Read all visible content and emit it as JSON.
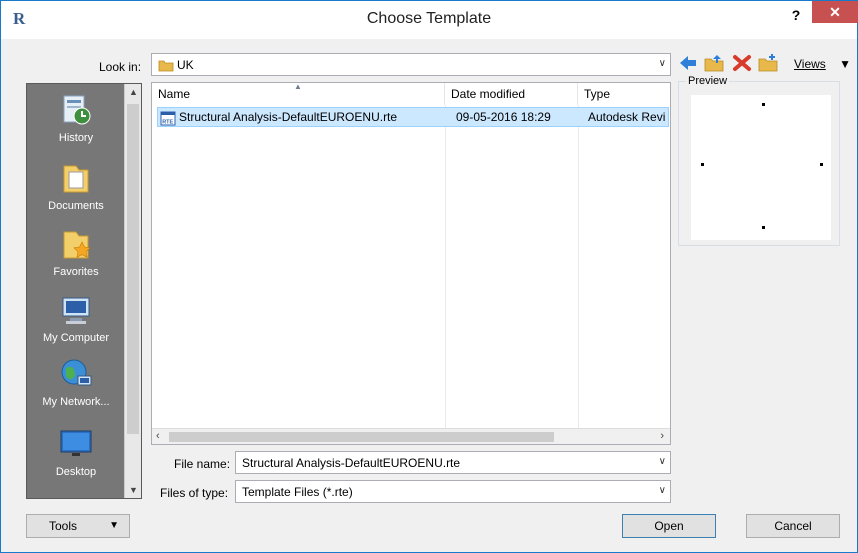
{
  "window": {
    "title": "Choose Template",
    "help_label": "?",
    "close_label": "✕",
    "app_icon": "revit-r-icon"
  },
  "look_in": {
    "label": "Look in:",
    "value": "UK"
  },
  "toolbar": {
    "icons": [
      "back-arrow-icon",
      "up-folder-icon",
      "delete-icon",
      "new-folder-icon"
    ],
    "views_label": "Views"
  },
  "places": [
    {
      "label": "History",
      "icon": "history-icon"
    },
    {
      "label": "Documents",
      "icon": "documents-folder-icon"
    },
    {
      "label": "Favorites",
      "icon": "favorites-folder-icon"
    },
    {
      "label": "My Computer",
      "icon": "my-computer-icon"
    },
    {
      "label": "My Network...",
      "icon": "network-globe-icon"
    },
    {
      "label": "Desktop",
      "icon": "desktop-monitor-icon"
    }
  ],
  "file_list": {
    "columns": [
      "Name",
      "Date modified",
      "Type"
    ],
    "rows": [
      {
        "name": "Structural Analysis-DefaultEUROENU.rte",
        "date_modified": "09-05-2016 18:29",
        "type": "Autodesk Revi"
      }
    ]
  },
  "preview": {
    "label": "Preview"
  },
  "file_name": {
    "label": "File name:",
    "value": "Structural Analysis-DefaultEUROENU.rte"
  },
  "file_type": {
    "label": "Files of type:",
    "value": "Template Files  (*.rte)"
  },
  "buttons": {
    "tools": "Tools",
    "open": "Open",
    "cancel": "Cancel"
  },
  "colors": {
    "accent": "#1979ca",
    "selection": "#cce8ff",
    "places_bg": "#777777",
    "close_red": "#c75050"
  }
}
